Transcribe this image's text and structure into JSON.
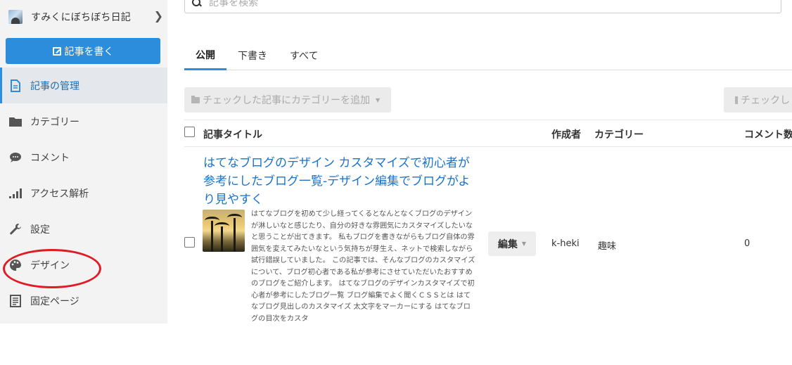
{
  "sidebar": {
    "blog_name": "すみくにぼちぼち日記",
    "write_button": "記事を書く",
    "items": [
      {
        "label": "記事の管理",
        "icon": "document-icon",
        "active": true
      },
      {
        "label": "カテゴリー",
        "icon": "folder-icon",
        "active": false
      },
      {
        "label": "コメント",
        "icon": "comment-icon",
        "active": false
      },
      {
        "label": "アクセス解析",
        "icon": "bar-chart-icon",
        "active": false
      },
      {
        "label": "設定",
        "icon": "wrench-icon",
        "active": false
      },
      {
        "label": "デザイン",
        "icon": "palette-icon",
        "active": false
      },
      {
        "label": "固定ページ",
        "icon": "page-icon",
        "active": false
      }
    ]
  },
  "search": {
    "placeholder": "記事を検索"
  },
  "tabs": [
    {
      "label": "公開",
      "active": true
    },
    {
      "label": "下書き",
      "active": false
    },
    {
      "label": "すべて",
      "active": false
    }
  ],
  "bulk_actions": {
    "add_category": "チェックした記事にカテゴリーを追加",
    "delete": "チェックし"
  },
  "table": {
    "headers": {
      "title": "記事タイトル",
      "author": "作成者",
      "category": "カテゴリー",
      "comments": "コメント数"
    },
    "rows": [
      {
        "title": "はてなブログのデザイン カスタマイズで初心者が参考にしたブログ一覧-デザイン編集でブログがより見やすく",
        "excerpt": "はてなブログを初めて少し経ってくるとなんとなくブログのデザインが淋しいなと感じたり、自分の好きな雰囲気にカスタマイズしたいなと思うことが出てきます。 私もブログを書きながらもブログ自体の雰囲気を変えてみたいなという気持ちが芽生え、ネットで検索しながら試行錯誤していました。 この記事では、そんなブログのカスタマイズについて、ブログ初心者である私が参考にさせていただいたおすすめのブログをご紹介します。 はてなブログのデザインカスタマイズで初心者が参考にしたブログ一覧 ブログ編集でよく聞くＣＳＳとは はてなブログ見出しのカスタマイズ 太文字をマーカーにする はてなブログの目次をカスタ",
        "edit_label": "編集",
        "author": "k-heki",
        "category": "趣味",
        "comments": "0"
      }
    ]
  },
  "colors": {
    "accent": "#2b8ddb",
    "link": "#1a73c9",
    "annotation": "#e01b24"
  }
}
